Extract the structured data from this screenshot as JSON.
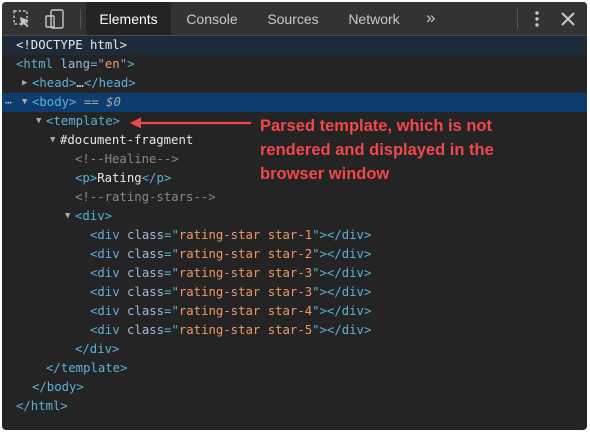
{
  "toolbar": {
    "tabs": [
      "Elements",
      "Console",
      "Sources",
      "Network"
    ],
    "active_tab": "Elements",
    "more_tabs": "»",
    "close": "✕",
    "icons": [
      "inspect-icon",
      "device-toggle-icon",
      "more-tabs-icon",
      "kebab-menu-icon",
      "close-icon"
    ]
  },
  "tree": {
    "doctype": "<!DOCTYPE html>",
    "html_open": "<html",
    "html_attr": " lang",
    "html_eq": "=\"",
    "html_val": "en",
    "html_close": "\">",
    "head": "<head>",
    "head_ellipsis": "…",
    "head_end": "</head>",
    "body": "<body>",
    "body_eq": " == ",
    "body_dollar": "$0",
    "template": "<template>",
    "fragment": "#document-fragment",
    "comment1": "<!--Healine-->",
    "p_open": "<p>",
    "p_text": "Rating",
    "p_close": "</p>",
    "comment2": "<!--rating-stars-->",
    "div_open": "<div>",
    "div_tag": "<div",
    "class_attr": " class",
    "class_eq": "=\"",
    "div_tag_end": "\"></div>",
    "star_classes": [
      "rating-star star-1",
      "rating-star star-2",
      "rating-star star-3",
      "rating-star star-3",
      "rating-star star-4",
      "rating-star star-5"
    ],
    "div_close": "</div>",
    "template_close": "</template>",
    "body_close": "</body>",
    "html_end": "</html>",
    "dots": "⋯"
  },
  "annotation": {
    "text": "Parsed template, which is not\nrendered and displayed in the\nbrowser window",
    "color": "#f0474b"
  },
  "colors": {
    "tag": "#5db0d7",
    "attribute": "#9bbbdc",
    "value": "#f29766",
    "comment": "#898989",
    "selection": "#0c3d6e"
  }
}
